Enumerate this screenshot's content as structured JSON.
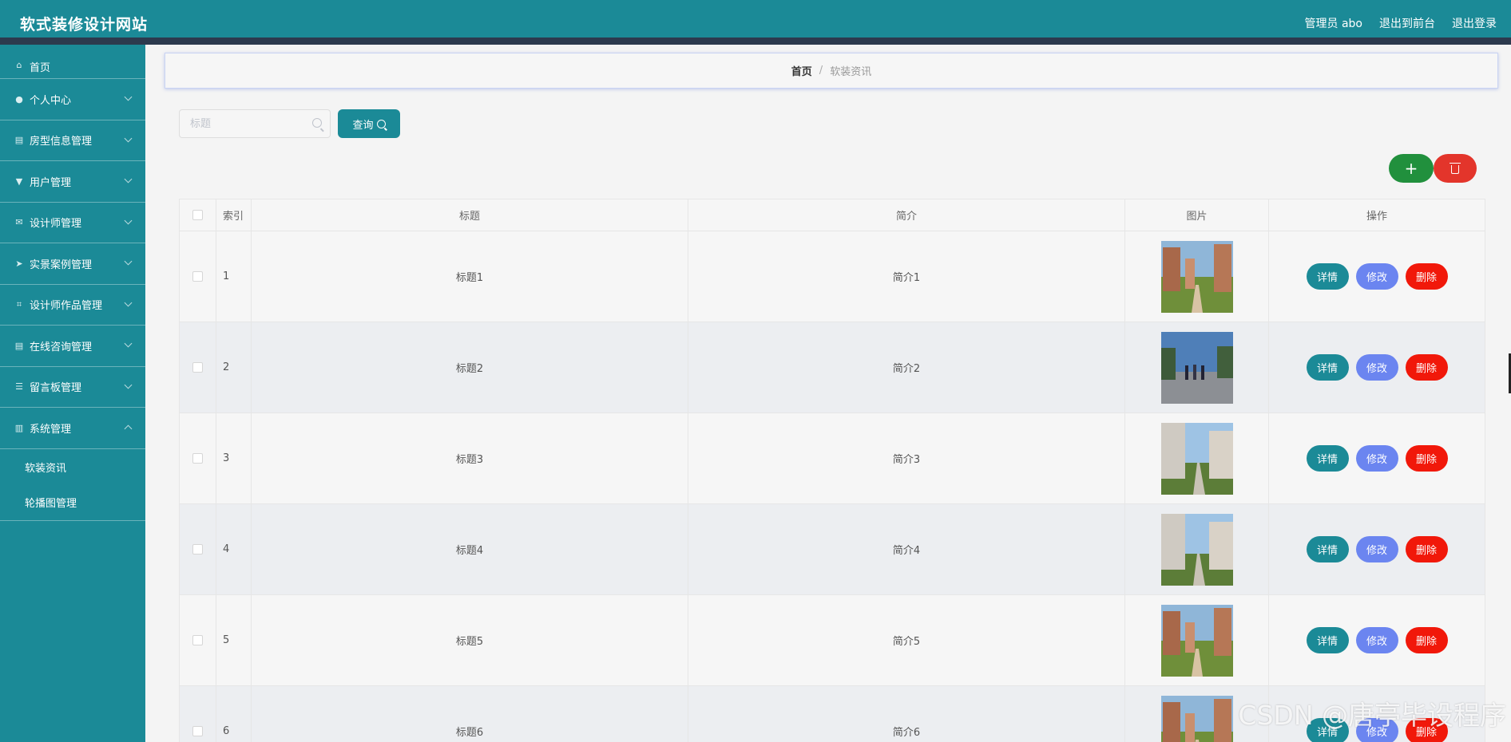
{
  "header": {
    "site_title": "软式装修设计网站",
    "admin_label": "管理员 abo",
    "back_to_front": "退出到前台",
    "logout": "退出登录"
  },
  "sidebar": {
    "items": [
      {
        "label": "首页",
        "icon": "home-icon"
      },
      {
        "label": "个人中心",
        "icon": "user-icon"
      },
      {
        "label": "房型信息管理",
        "icon": "clipboard-icon"
      },
      {
        "label": "用户管理",
        "icon": "stamp-icon"
      },
      {
        "label": "设计师管理",
        "icon": "mail-icon"
      },
      {
        "label": "实景案例管理",
        "icon": "location-icon"
      },
      {
        "label": "设计师作品管理",
        "icon": "crop-icon"
      },
      {
        "label": "在线咨询管理",
        "icon": "clipboard-icon"
      },
      {
        "label": "留言板管理",
        "icon": "list-icon"
      },
      {
        "label": "系统管理",
        "icon": "chart-icon"
      }
    ],
    "sub_items": [
      "软装资讯",
      "轮播图管理"
    ]
  },
  "breadcrumb": {
    "home": "首页",
    "separator": "/",
    "current": "软装资讯"
  },
  "search": {
    "placeholder": "标题",
    "value": "",
    "query_label": "查询"
  },
  "toolbar": {
    "add_label": "+"
  },
  "table": {
    "headers": {
      "index": "索引",
      "title": "标题",
      "intro": "简介",
      "image": "图片",
      "ops": "操作"
    },
    "rows": [
      {
        "index": "1",
        "title": "标题1",
        "intro": "简介1"
      },
      {
        "index": "2",
        "title": "标题2",
        "intro": "简介2"
      },
      {
        "index": "3",
        "title": "标题3",
        "intro": "简介3"
      },
      {
        "index": "4",
        "title": "标题4",
        "intro": "简介4"
      },
      {
        "index": "5",
        "title": "标题5",
        "intro": "简介5"
      },
      {
        "index": "6",
        "title": "标题6",
        "intro": "简介6"
      }
    ],
    "ops": {
      "detail": "详情",
      "edit": "修改",
      "delete": "删除"
    }
  },
  "watermark": "CSDN @唐亭毕设程序",
  "colors": {
    "primary": "#1b8a97",
    "edit": "#6b85f0",
    "delete": "#f1180a",
    "add": "#21903d"
  }
}
